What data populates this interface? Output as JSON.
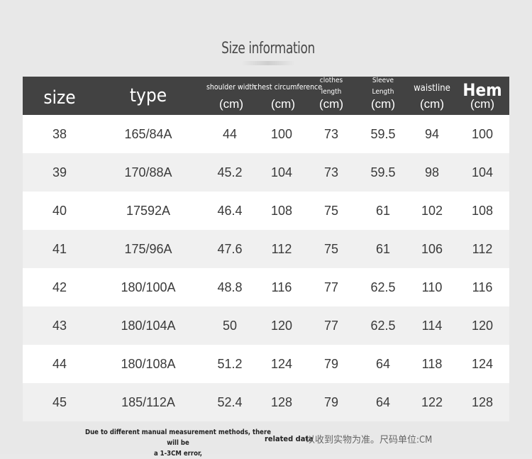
{
  "title": "Size information",
  "headers": {
    "size": "size",
    "type": "type",
    "shoulder": "shoulder width",
    "chest": "chest circumference",
    "clothes_1": "clothes",
    "clothes_2": "length",
    "sleeve_1": "Sleeve",
    "sleeve_2": "Length",
    "waist": "waistline",
    "hem": "Hem",
    "unit": "(cm)"
  },
  "rows": [
    [
      "38",
      "165/84A",
      "44",
      "100",
      "73",
      "59.5",
      "94",
      "100"
    ],
    [
      "39",
      "170/88A",
      "45.2",
      "104",
      "73",
      "59.5",
      "98",
      "104"
    ],
    [
      "40",
      "17592A",
      "46.4",
      "108",
      "75",
      "61",
      "102",
      "108"
    ],
    [
      "41",
      "175/96A",
      "47.6",
      "112",
      "75",
      "61",
      "106",
      "112"
    ],
    [
      "42",
      "180/100A",
      "48.8",
      "116",
      "77",
      "62.5",
      "110",
      "116"
    ],
    [
      "43",
      "180/104A",
      "50",
      "120",
      "77",
      "62.5",
      "114",
      "120"
    ],
    [
      "44",
      "180/108A",
      "51.2",
      "124",
      "79",
      "64",
      "118",
      "124"
    ],
    [
      "45",
      "185/112A",
      "52.4",
      "128",
      "79",
      "64",
      "122",
      "128"
    ]
  ],
  "notes": {
    "line1": "Due to different manual measurement methods, there will be",
    "line2": "a 1-3CM error,",
    "related": "related data",
    "cn": "以收到实物为准。尺码单位:CM"
  },
  "colors": {
    "header_bg": "#424242",
    "row_white": "#ffffff",
    "row_gray": "#f0f0f0",
    "page_bg": "#e8e8e8"
  }
}
